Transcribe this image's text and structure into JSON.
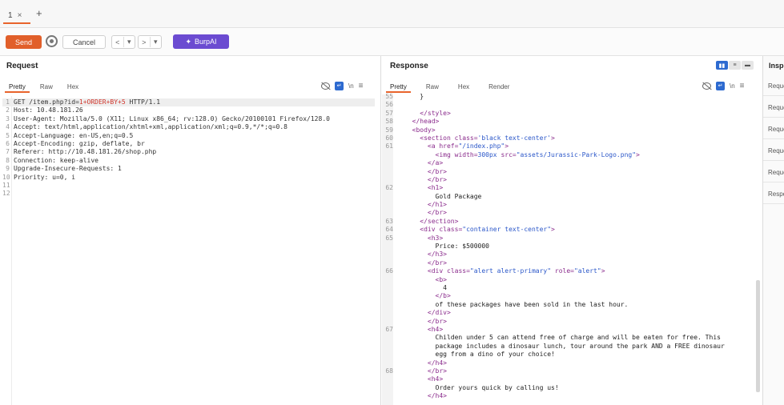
{
  "tabs": [
    {
      "label": "1",
      "close": "×"
    }
  ],
  "add_tab": "+",
  "toolbar": {
    "send_label": "Send",
    "cancel_label": "Cancel",
    "back_label": "<",
    "back_dropdown": "▾",
    "fwd_label": ">",
    "fwd_dropdown": "▾",
    "burpai_label": "BurpAI",
    "burpai_icon": "✦"
  },
  "request": {
    "title": "Request",
    "subtabs": [
      "Pretty",
      "Raw",
      "Hex"
    ],
    "icon_ln": "\\n",
    "icon_menu": "≡",
    "lines": [
      {
        "n": "1",
        "pre": "GET /item.php?id=",
        "red": "1+ORDER+BY+5",
        "post": " HTTP/1.1"
      },
      {
        "n": "2",
        "pre": "Host: 10.48.181.26",
        "red": "",
        "post": ""
      },
      {
        "n": "3",
        "pre": "User-Agent: Mozilla/5.0 (X11; Linux x86_64; rv:128.0) Gecko/20100101 Firefox/128.0",
        "red": "",
        "post": ""
      },
      {
        "n": "4",
        "pre": "Accept: text/html,application/xhtml+xml,application/xml;q=0.9,*/*;q=0.8",
        "red": "",
        "post": ""
      },
      {
        "n": "5",
        "pre": "Accept-Language: en-US,en;q=0.5",
        "red": "",
        "post": ""
      },
      {
        "n": "6",
        "pre": "Accept-Encoding: gzip, deflate, br",
        "red": "",
        "post": ""
      },
      {
        "n": "7",
        "pre": "Referer: http://10.48.181.26/shop.php",
        "red": "",
        "post": ""
      },
      {
        "n": "8",
        "pre": "Connection: keep-alive",
        "red": "",
        "post": ""
      },
      {
        "n": "9",
        "pre": "Upgrade-Insecure-Requests: 1",
        "red": "",
        "post": ""
      },
      {
        "n": "10",
        "pre": "Priority: u=0, i",
        "red": "",
        "post": ""
      },
      {
        "n": "11",
        "pre": "",
        "red": "",
        "post": ""
      },
      {
        "n": "12",
        "pre": "",
        "red": "",
        "post": ""
      }
    ]
  },
  "response": {
    "title": "Response",
    "subtabs": [
      "Pretty",
      "Raw",
      "Hex",
      "Render"
    ],
    "icon_ln": "\\n",
    "icon_menu": "≡",
    "view_modes": [
      "▮▮",
      "≡",
      "▬"
    ],
    "lines": [
      {
        "n": "55",
        "ind": 2,
        "seg": [
          {
            "c": "txt",
            "t": "}"
          }
        ]
      },
      {
        "n": "56",
        "ind": 0,
        "seg": []
      },
      {
        "n": "57",
        "ind": 2,
        "seg": [
          {
            "c": "tag",
            "t": "</style>"
          }
        ]
      },
      {
        "n": "58",
        "ind": 1,
        "seg": [
          {
            "c": "tag",
            "t": "</head>"
          }
        ]
      },
      {
        "n": "59",
        "ind": 1,
        "seg": [
          {
            "c": "tag",
            "t": "<body>"
          }
        ]
      },
      {
        "n": "60",
        "ind": 2,
        "seg": [
          {
            "c": "tag",
            "t": "<section "
          },
          {
            "c": "attr",
            "t": "class="
          },
          {
            "c": "str",
            "t": "'black text-center'"
          },
          {
            "c": "tag",
            "t": ">"
          }
        ]
      },
      {
        "n": "61",
        "ind": 3,
        "seg": [
          {
            "c": "tag",
            "t": "<a "
          },
          {
            "c": "attr",
            "t": "href="
          },
          {
            "c": "str",
            "t": "\"/index.php\""
          },
          {
            "c": "tag",
            "t": ">"
          }
        ]
      },
      {
        "n": "",
        "ind": 4,
        "seg": [
          {
            "c": "tag",
            "t": "<img "
          },
          {
            "c": "attr",
            "t": "width="
          },
          {
            "c": "str",
            "t": "300px "
          },
          {
            "c": "attr",
            "t": "src="
          },
          {
            "c": "str",
            "t": "\"assets/Jurassic-Park-Logo.png\""
          },
          {
            "c": "tag",
            "t": ">"
          }
        ]
      },
      {
        "n": "",
        "ind": 3,
        "seg": [
          {
            "c": "tag",
            "t": "</a>"
          }
        ]
      },
      {
        "n": "",
        "ind": 3,
        "seg": [
          {
            "c": "tag",
            "t": "</br>"
          }
        ]
      },
      {
        "n": "",
        "ind": 3,
        "seg": [
          {
            "c": "tag",
            "t": "</br>"
          }
        ]
      },
      {
        "n": "62",
        "ind": 3,
        "seg": [
          {
            "c": "tag",
            "t": "<h1>"
          }
        ]
      },
      {
        "n": "",
        "ind": 4,
        "seg": [
          {
            "c": "txt",
            "t": "Gold Package"
          }
        ]
      },
      {
        "n": "",
        "ind": 3,
        "seg": [
          {
            "c": "tag",
            "t": "</h1>"
          }
        ]
      },
      {
        "n": "",
        "ind": 3,
        "seg": [
          {
            "c": "tag",
            "t": "</br>"
          }
        ]
      },
      {
        "n": "63",
        "ind": 2,
        "seg": [
          {
            "c": "tag",
            "t": "</section>"
          }
        ]
      },
      {
        "n": "64",
        "ind": 2,
        "seg": [
          {
            "c": "tag",
            "t": "<div "
          },
          {
            "c": "attr",
            "t": "class="
          },
          {
            "c": "str",
            "t": "\"container text-center\""
          },
          {
            "c": "tag",
            "t": ">"
          }
        ]
      },
      {
        "n": "65",
        "ind": 3,
        "seg": [
          {
            "c": "tag",
            "t": "<h3>"
          }
        ]
      },
      {
        "n": "",
        "ind": 4,
        "seg": [
          {
            "c": "txt",
            "t": "Price: $500000"
          }
        ]
      },
      {
        "n": "",
        "ind": 3,
        "seg": [
          {
            "c": "tag",
            "t": "</h3>"
          }
        ]
      },
      {
        "n": "",
        "ind": 3,
        "seg": [
          {
            "c": "tag",
            "t": "</br>"
          }
        ]
      },
      {
        "n": "66",
        "ind": 3,
        "seg": [
          {
            "c": "tag",
            "t": "<div "
          },
          {
            "c": "attr",
            "t": "class="
          },
          {
            "c": "str",
            "t": "\"alert alert-primary\" "
          },
          {
            "c": "attr",
            "t": "role="
          },
          {
            "c": "str",
            "t": "\"alert\""
          },
          {
            "c": "tag",
            "t": ">"
          }
        ]
      },
      {
        "n": "",
        "ind": 4,
        "seg": [
          {
            "c": "tag",
            "t": "<b>"
          }
        ]
      },
      {
        "n": "",
        "ind": 5,
        "seg": [
          {
            "c": "txt",
            "t": "4"
          }
        ]
      },
      {
        "n": "",
        "ind": 4,
        "seg": [
          {
            "c": "tag",
            "t": "</b>"
          }
        ]
      },
      {
        "n": "",
        "ind": 4,
        "seg": [
          {
            "c": "txt",
            "t": "of these packages have been sold in the last hour."
          }
        ]
      },
      {
        "n": "",
        "ind": 3,
        "seg": [
          {
            "c": "tag",
            "t": "</div>"
          }
        ]
      },
      {
        "n": "",
        "ind": 3,
        "seg": [
          {
            "c": "tag",
            "t": "</br>"
          }
        ]
      },
      {
        "n": "67",
        "ind": 3,
        "seg": [
          {
            "c": "tag",
            "t": "<h4>"
          }
        ]
      },
      {
        "n": "",
        "ind": 4,
        "seg": [
          {
            "c": "txt",
            "t": "Childen under 5 can attend free of charge and will be eaten for free. This"
          }
        ]
      },
      {
        "n": "",
        "ind": 4,
        "seg": [
          {
            "c": "txt",
            "t": "package includes a dinosaur lunch, tour around the park AND a FREE dinosaur"
          }
        ]
      },
      {
        "n": "",
        "ind": 4,
        "seg": [
          {
            "c": "txt",
            "t": "egg from a dino of your choice!"
          }
        ]
      },
      {
        "n": "",
        "ind": 3,
        "seg": [
          {
            "c": "tag",
            "t": "</h4>"
          }
        ]
      },
      {
        "n": "68",
        "ind": 3,
        "seg": [
          {
            "c": "tag",
            "t": "</br>"
          }
        ]
      },
      {
        "n": "",
        "ind": 3,
        "seg": [
          {
            "c": "tag",
            "t": "<h4>"
          }
        ]
      },
      {
        "n": "",
        "ind": 4,
        "seg": [
          {
            "c": "txt",
            "t": "Order yours quick by calling us!"
          }
        ]
      },
      {
        "n": "",
        "ind": 3,
        "seg": [
          {
            "c": "tag",
            "t": "</h4>"
          }
        ]
      }
    ]
  },
  "inspector": {
    "title": "Inspector",
    "items": [
      "Request attributes",
      "Request query parameters",
      "Request body parameters",
      "Request cookies",
      "Request headers",
      "Response headers"
    ]
  }
}
